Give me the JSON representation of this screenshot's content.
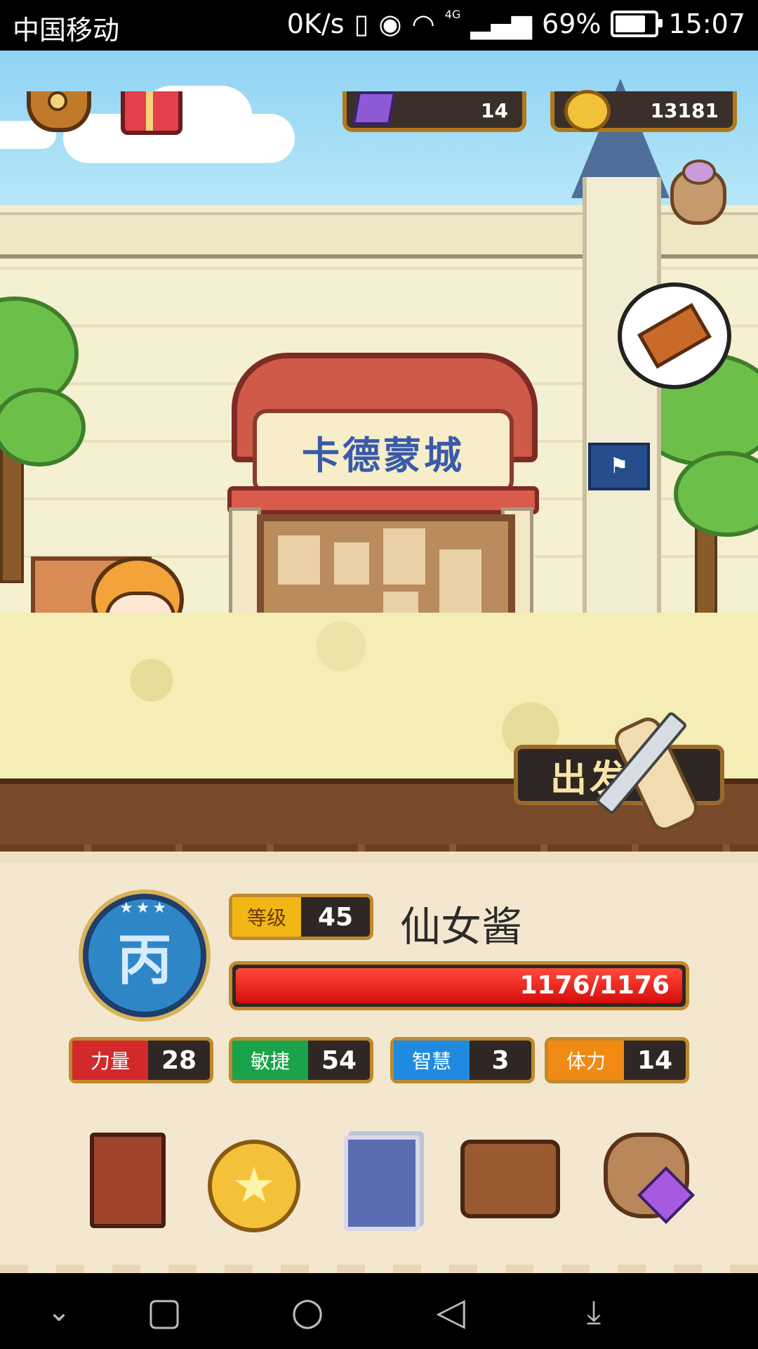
{
  "status_bar": {
    "carrier": "中国移动",
    "speed": "0K/s",
    "network": "4G",
    "battery": "69%",
    "battery_level": 0.69,
    "time": "15:07",
    "icons": [
      "vibrate-icon",
      "eye-icon",
      "wifi-icon",
      "signal-icon",
      "battery-icon"
    ]
  },
  "hud": {
    "gems": "14",
    "coins": "13181",
    "icons": [
      "gear-icon",
      "gift-icon",
      "gem-icon",
      "coin-icon",
      "loot-pouch-icon"
    ]
  },
  "scene": {
    "shop_sign": "卡德蒙城",
    "depart_button": "出发"
  },
  "player": {
    "level_label": "等级",
    "level": "45",
    "name": "仙女酱",
    "rank_emblem": "丙",
    "hp": "1176/1176",
    "hp_fraction": 1.0,
    "stats": [
      {
        "label": "力量",
        "value": "28",
        "color": "#d22a2a"
      },
      {
        "label": "敏捷",
        "value": "54",
        "color": "#1aa34a"
      },
      {
        "label": "智慧",
        "value": "3",
        "color": "#1f8ae0"
      },
      {
        "label": "体力",
        "value": "14",
        "color": "#f08a12"
      }
    ]
  },
  "menu_icons": [
    "hero-book-icon",
    "star-coin-icon",
    "card-deck-icon",
    "inventory-bag-icon",
    "treasure-pouch-icon"
  ],
  "nav_bar": {
    "icons": [
      "collapse-icon",
      "recents-icon",
      "home-icon",
      "back-icon",
      "notifications-icon"
    ]
  }
}
